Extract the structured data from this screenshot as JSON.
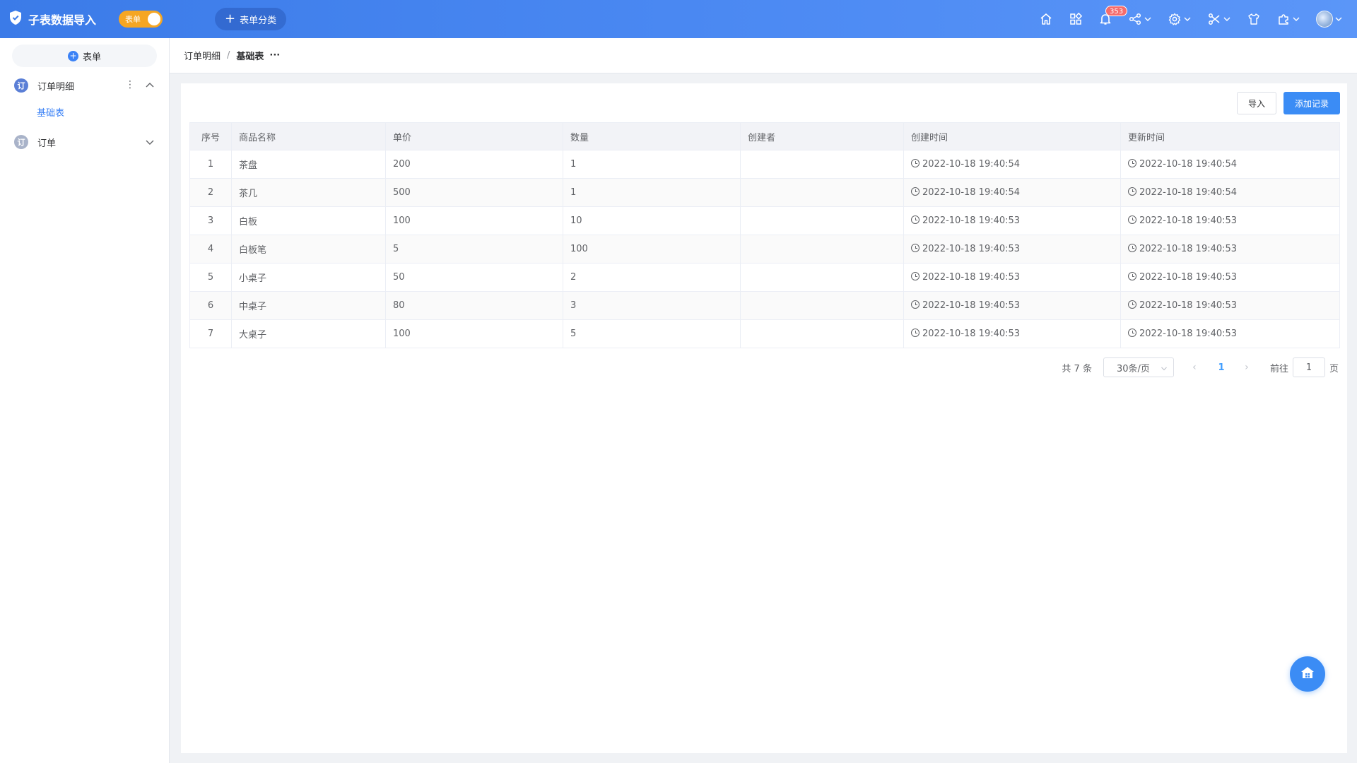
{
  "header": {
    "app_title": "子表数据导入",
    "toggle_label": "表单",
    "category_button": "表单分类",
    "notification_count": "353",
    "icons": [
      "home-icon",
      "apps-icon",
      "bell-icon",
      "share-icon",
      "gear-icon",
      "tools-icon",
      "shirt-icon",
      "puzzle-icon",
      "avatar"
    ]
  },
  "sidebar": {
    "add_button": "表单",
    "groups": [
      {
        "icon_text": "订",
        "label": "订单明细",
        "expanded": true,
        "children": [
          {
            "label": "基础表",
            "active": true
          }
        ]
      },
      {
        "icon_text": "订",
        "label": "订单",
        "expanded": false,
        "children": []
      }
    ]
  },
  "breadcrumb": {
    "items": [
      "订单明细",
      "基础表"
    ],
    "separator": "/",
    "more": "···"
  },
  "toolbar": {
    "import_label": "导入",
    "add_record_label": "添加记录"
  },
  "table": {
    "columns": [
      "序号",
      "商品名称",
      "单价",
      "数量",
      "创建者",
      "创建时间",
      "更新时间"
    ],
    "rows": [
      [
        "1",
        "茶盘",
        "200",
        "1",
        "",
        "2022-10-18 19:40:54",
        "2022-10-18 19:40:54"
      ],
      [
        "2",
        "茶几",
        "500",
        "1",
        "",
        "2022-10-18 19:40:54",
        "2022-10-18 19:40:54"
      ],
      [
        "3",
        "白板",
        "100",
        "10",
        "",
        "2022-10-18 19:40:53",
        "2022-10-18 19:40:53"
      ],
      [
        "4",
        "白板笔",
        "5",
        "100",
        "",
        "2022-10-18 19:40:53",
        "2022-10-18 19:40:53"
      ],
      [
        "5",
        "小桌子",
        "50",
        "2",
        "",
        "2022-10-18 19:40:53",
        "2022-10-18 19:40:53"
      ],
      [
        "6",
        "中桌子",
        "80",
        "3",
        "",
        "2022-10-18 19:40:53",
        "2022-10-18 19:40:53"
      ],
      [
        "7",
        "大桌子",
        "100",
        "5",
        "",
        "2022-10-18 19:40:53",
        "2022-10-18 19:40:53"
      ]
    ]
  },
  "pagination": {
    "total": "共 7 条",
    "page_size": "30条/页",
    "current_page": "1",
    "goto_label": "前往",
    "goto_value": "1",
    "page_suffix": "页"
  },
  "colors": {
    "header_gradient_start": "#3b7be8",
    "header_gradient_end": "#5b96f8",
    "primary": "#3b8cf5",
    "toggle": "#f5a623",
    "badge": "#f56c6c"
  }
}
